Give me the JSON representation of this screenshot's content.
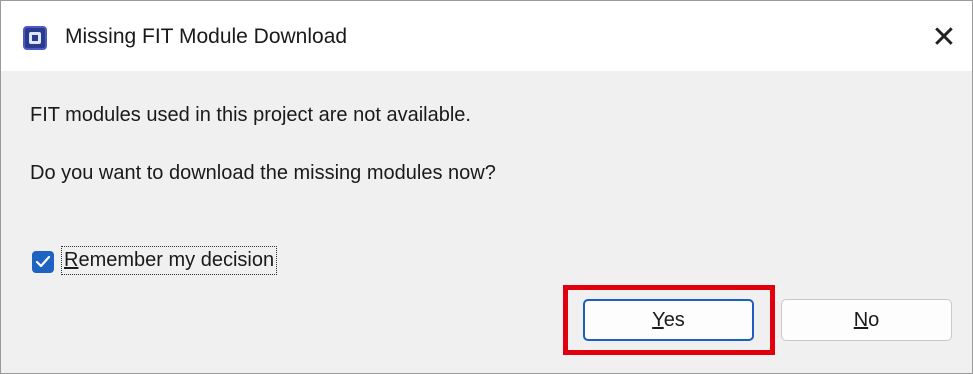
{
  "window": {
    "title": "Missing FIT Module Download",
    "app_icon": "renesas-chip-icon",
    "close_glyph": "✕"
  },
  "message": {
    "line1": "FIT modules used in this project are not available.",
    "line2": "Do you want to download the missing modules now?"
  },
  "remember": {
    "checked": true,
    "label_mnemonic": "R",
    "label_rest": "emember my decision"
  },
  "buttons": {
    "yes": {
      "mnemonic": "Y",
      "rest": "es"
    },
    "no": {
      "mnemonic": "N",
      "rest": "o"
    }
  },
  "colors": {
    "accent": "#1f63c2",
    "highlight": "#e0000e",
    "content_bg": "#f0f0f0"
  }
}
